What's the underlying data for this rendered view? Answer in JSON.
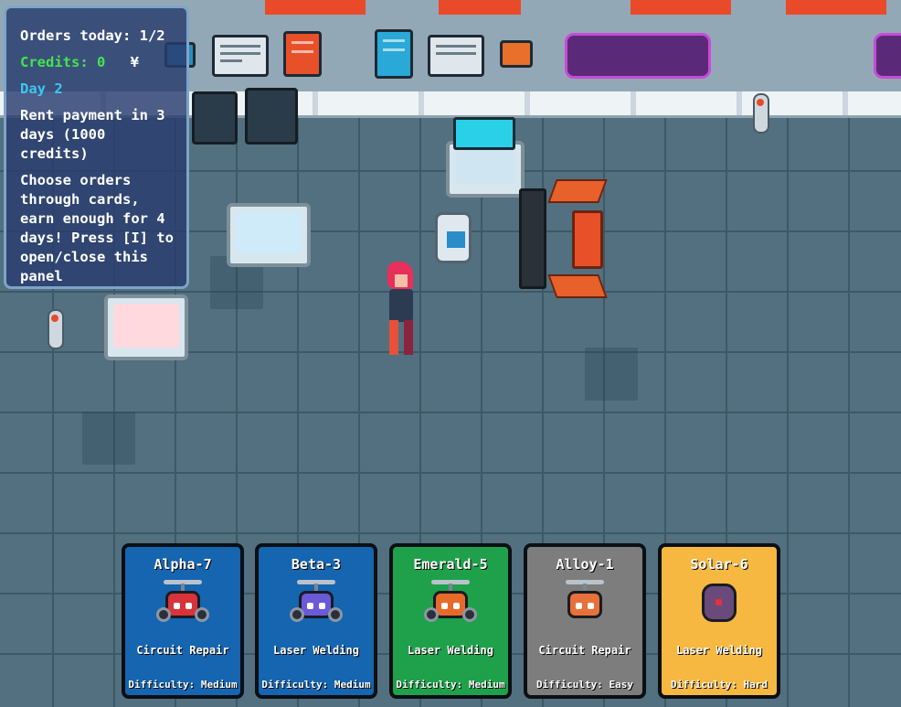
{
  "hud": {
    "orders_today": "Orders today: 1/2",
    "credits": "Credits: 0",
    "currency_symbol": "¥",
    "day": "Day 2",
    "rent": "Rent payment in 3 days (1000 credits)",
    "instructions": "Choose orders through cards, earn enough for 4 days! Press [I] to open/close this panel"
  },
  "cards": [
    {
      "name": "Alpha-7",
      "task": "Circuit Repair",
      "difficulty": "Difficulty: Medium",
      "color": "#1565b0",
      "drone_color": "#d8333a"
    },
    {
      "name": "Beta-3",
      "task": "Laser Welding",
      "difficulty": "Difficulty: Medium",
      "color": "#1565b0",
      "drone_color": "#6a5ad8"
    },
    {
      "name": "Emerald-5",
      "task": "Laser Welding",
      "difficulty": "Difficulty: Medium",
      "color": "#1ea14a",
      "drone_color": "#e86a2a"
    },
    {
      "name": "Alloy-1",
      "task": "Circuit Repair",
      "difficulty": "Difficulty: Easy",
      "color": "#7d7d7d",
      "drone_color": "#e8703a"
    },
    {
      "name": "Solar-6",
      "task": "Laser Welding",
      "difficulty": "Difficulty: Hard",
      "color": "#f6b840",
      "drone_color": "#6a4a7a"
    }
  ],
  "colors": {
    "wall": "#93a8b6",
    "floor": "#52707f",
    "accent_red": "#e84a2a",
    "screen_cyan": "#3cc8f0"
  }
}
